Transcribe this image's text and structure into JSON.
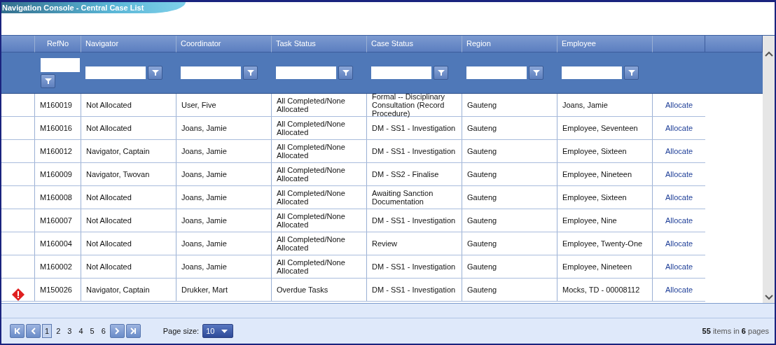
{
  "window": {
    "title": "Navigation Console - Central Case List"
  },
  "table": {
    "columns": [
      "RefNo",
      "Navigator",
      "Coordinator",
      "Task Status",
      "Case Status",
      "Region",
      "Employee"
    ],
    "rows": [
      {
        "warning": false,
        "cells": [
          "M160019",
          "Not Allocated",
          "User, Five",
          "All Completed/None Allocated",
          "Formal -- Disciplinary Consultation (Record Procedure)",
          "Gauteng",
          "Joans, Jamie"
        ],
        "action": "Allocate"
      },
      {
        "warning": false,
        "cells": [
          "M160016",
          "Not Allocated",
          "Joans, Jamie",
          "All Completed/None Allocated",
          "DM - SS1 - Investigation",
          "Gauteng",
          "Employee, Seventeen"
        ],
        "action": "Allocate"
      },
      {
        "warning": false,
        "cells": [
          "M160012",
          "Navigator, Captain",
          "Joans, Jamie",
          "All Completed/None Allocated",
          "DM - SS1 - Investigation",
          "Gauteng",
          "Employee, Sixteen"
        ],
        "action": "Allocate"
      },
      {
        "warning": false,
        "cells": [
          "M160009",
          "Navigator, Twovan",
          "Joans, Jamie",
          "All Completed/None Allocated",
          "DM - SS2 - Finalise",
          "Gauteng",
          "Employee, Nineteen"
        ],
        "action": "Allocate"
      },
      {
        "warning": false,
        "cells": [
          "M160008",
          "Not Allocated",
          "Joans, Jamie",
          "All Completed/None Allocated",
          "Awaiting Sanction Documentation",
          "Gauteng",
          "Employee, Sixteen"
        ],
        "action": "Allocate"
      },
      {
        "warning": false,
        "cells": [
          "M160007",
          "Not Allocated",
          "Joans, Jamie",
          "All Completed/None Allocated",
          "DM - SS1 - Investigation",
          "Gauteng",
          "Employee, Nine"
        ],
        "action": "Allocate"
      },
      {
        "warning": false,
        "cells": [
          "M160004",
          "Not Allocated",
          "Joans, Jamie",
          "All Completed/None Allocated",
          "Review",
          "Gauteng",
          "Employee, Twenty-One"
        ],
        "action": "Allocate"
      },
      {
        "warning": false,
        "cells": [
          "M160002",
          "Not Allocated",
          "Joans, Jamie",
          "All Completed/None Allocated",
          "DM - SS1 - Investigation",
          "Gauteng",
          "Employee, Nineteen"
        ],
        "action": "Allocate"
      },
      {
        "warning": true,
        "cells": [
          "M150026",
          "Navigator, Captain",
          "Drukker, Mart",
          "Overdue Tasks",
          "DM - SS1 - Investigation",
          "Gauteng",
          "Mocks, TD - 00008112"
        ],
        "action": "Allocate"
      }
    ]
  },
  "pager": {
    "pages": [
      {
        "label": "1",
        "selected": true
      },
      {
        "label": "2",
        "selected": false
      },
      {
        "label": "3",
        "selected": false
      },
      {
        "label": "4",
        "selected": false
      },
      {
        "label": "5",
        "selected": false
      },
      {
        "label": "6",
        "selected": false
      }
    ],
    "page_size_label": "Page size:",
    "page_size": "10",
    "summary": "**55** items in **6** pages"
  }
}
